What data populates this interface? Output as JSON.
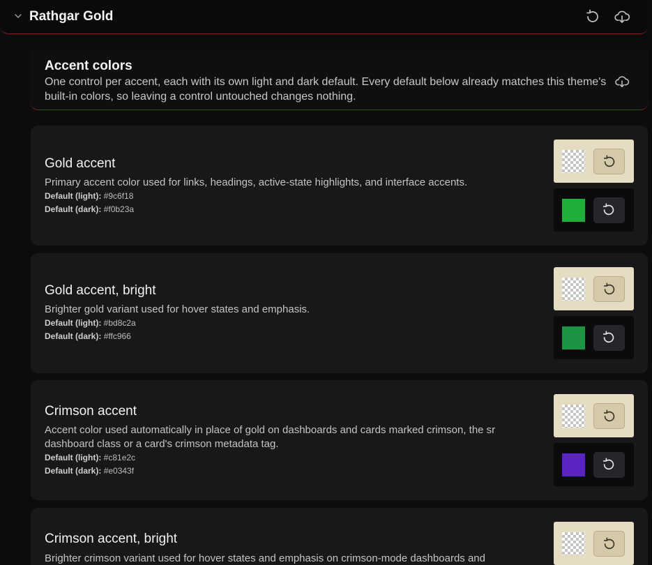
{
  "header": {
    "title": "Rathgar Gold",
    "icons": [
      "chevron-down-icon",
      "reset-icon",
      "cloud-download-icon"
    ]
  },
  "section": {
    "title": "Accent colors",
    "description": "One control per accent, each with its own light and dark default. Every default below already matches this theme's built-in colors, so leaving a control untouched changes nothing.",
    "icon": "cloud-download-icon"
  },
  "cards": [
    {
      "title": "Gold accent",
      "description": "Primary accent color used for links, headings, active-state highlights, and interface accents.",
      "default_light_label": "Default (light):",
      "default_light_value": "#9c6f18",
      "default_dark_label": "Default (dark):",
      "default_dark_value": "#f0b23a",
      "dark_swatch_color": "#1fae3a"
    },
    {
      "title": "Gold accent, bright",
      "description": "Brighter gold variant used for hover states and emphasis.",
      "default_light_label": "Default (light):",
      "default_light_value": "#bd8c2a",
      "default_dark_label": "Default (dark):",
      "default_dark_value": "#ffc966",
      "dark_swatch_color": "#1d9443"
    },
    {
      "title": "Crimson accent",
      "description": "Accent color used automatically in place of gold on dashboards and cards marked crimson, the sr dashboard class or a card's crimson metadata tag.",
      "default_light_label": "Default (light):",
      "default_light_value": "#c81e2c",
      "default_dark_label": "Default (dark):",
      "default_dark_value": "#e0343f",
      "dark_swatch_color": "#5a23c4"
    },
    {
      "title": "Crimson accent, bright",
      "description": "Brighter crimson variant used for hover states and emphasis on crimson-mode dashboards and"
    }
  ],
  "colors": {
    "background": "#0c0c0e",
    "card": "#18181b",
    "border_accent": "#8a1f1f",
    "light_row": "#e5dcc2"
  }
}
